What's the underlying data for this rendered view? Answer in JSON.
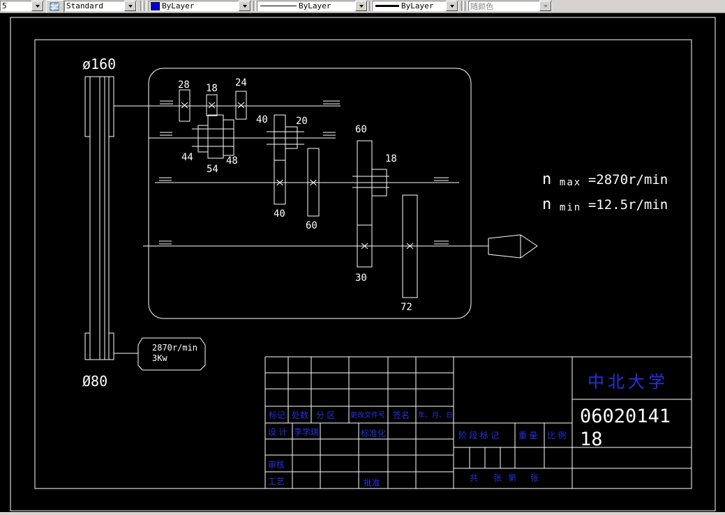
{
  "toolbar": {
    "partial_style": "5",
    "text_style": "Standard",
    "color": "ByLayer",
    "linetype": "ByLayer",
    "lineweight": "ByLayer",
    "plot_style": "随颜色"
  },
  "colors": {
    "canvas_bg": "#000000",
    "drawing_line": "#ffffff",
    "title_text_blue": "#2233dd",
    "university_blue": "#2233ee",
    "number_blue": "#2a2acd",
    "toolbar_bg": "#d6d3ce",
    "bylayer_swatch": "#0000e0"
  },
  "diagram": {
    "dia_top": "ø160",
    "dia_bottom": "Ø80",
    "motor_speed": "2870r/min",
    "motor_power": "3Kw",
    "n_sym": "n",
    "max_sub": "max",
    "max_val": "=2870r/min",
    "min_sub": "min",
    "min_val": "=12.5r/min",
    "gears": {
      "g28": "28",
      "g18a": "18",
      "g24": "24",
      "g40a": "40",
      "g20": "20",
      "g44": "44",
      "g54": "54",
      "g48": "48",
      "g40b": "40",
      "g60a": "60",
      "g60b": "60",
      "g18b": "18",
      "g30": "30",
      "g72": "72"
    }
  },
  "title_block": {
    "mark": "标记",
    "count": "处数",
    "zone": "分  区",
    "change_file_no": "更改文件号",
    "signature": "签名",
    "date": "年、月、日",
    "design": "设 计",
    "designer": "李学瑞",
    "standardization": "标准化",
    "check": "审核",
    "process": "工艺",
    "approve": "批准",
    "stage_mark": "阶 段 标 记",
    "weight": "重 量",
    "scale": "比 例",
    "total": "共",
    "sheets_1": "张",
    "no": "第",
    "sheets_2": "张",
    "university": "中北大学",
    "doc_number_1": "06020141",
    "doc_number_2": "18"
  }
}
